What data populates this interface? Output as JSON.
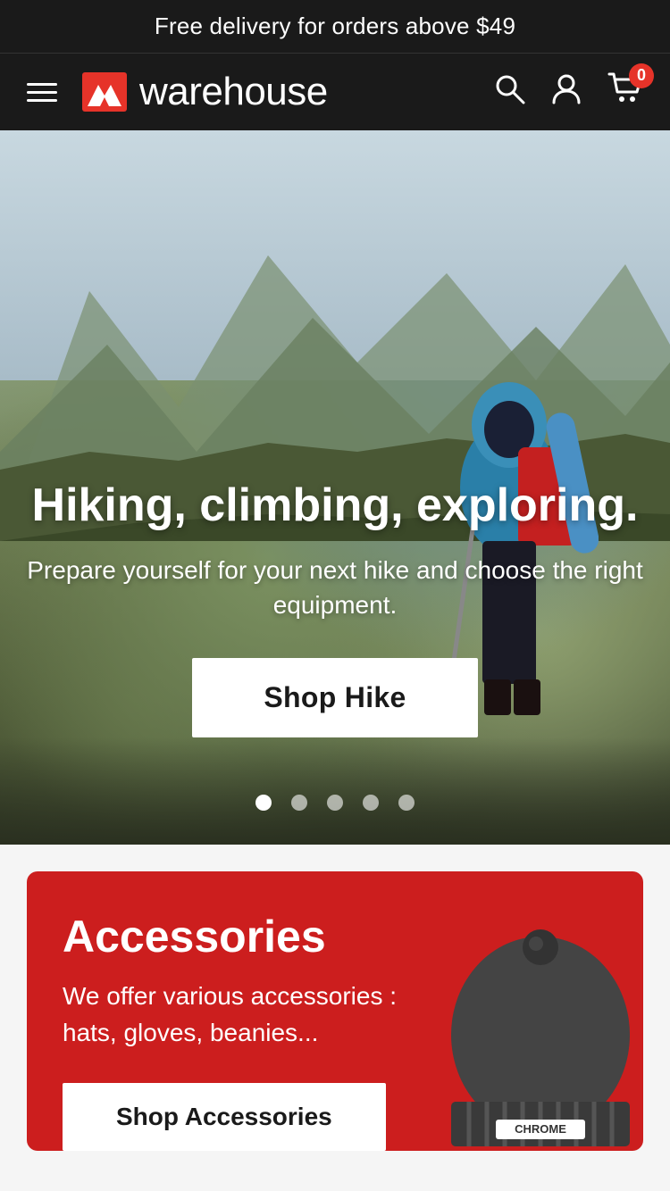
{
  "announcement": {
    "text": "Free delivery for orders above $49"
  },
  "header": {
    "logo_text": "warehouse",
    "cart_count": "0"
  },
  "hero": {
    "title": "Hiking, climbing, exploring.",
    "subtitle": "Prepare yourself for your next hike and choose the right equipment.",
    "cta_label": "Shop Hike",
    "dots": [
      {
        "active": true
      },
      {
        "active": false
      },
      {
        "active": false
      },
      {
        "active": false
      },
      {
        "active": false
      }
    ]
  },
  "accessories": {
    "title": "Accessories",
    "description": "We offer various accessories : hats, gloves, beanies...",
    "cta_label": "Shop Accessories",
    "beanie_label": "CHROME"
  }
}
